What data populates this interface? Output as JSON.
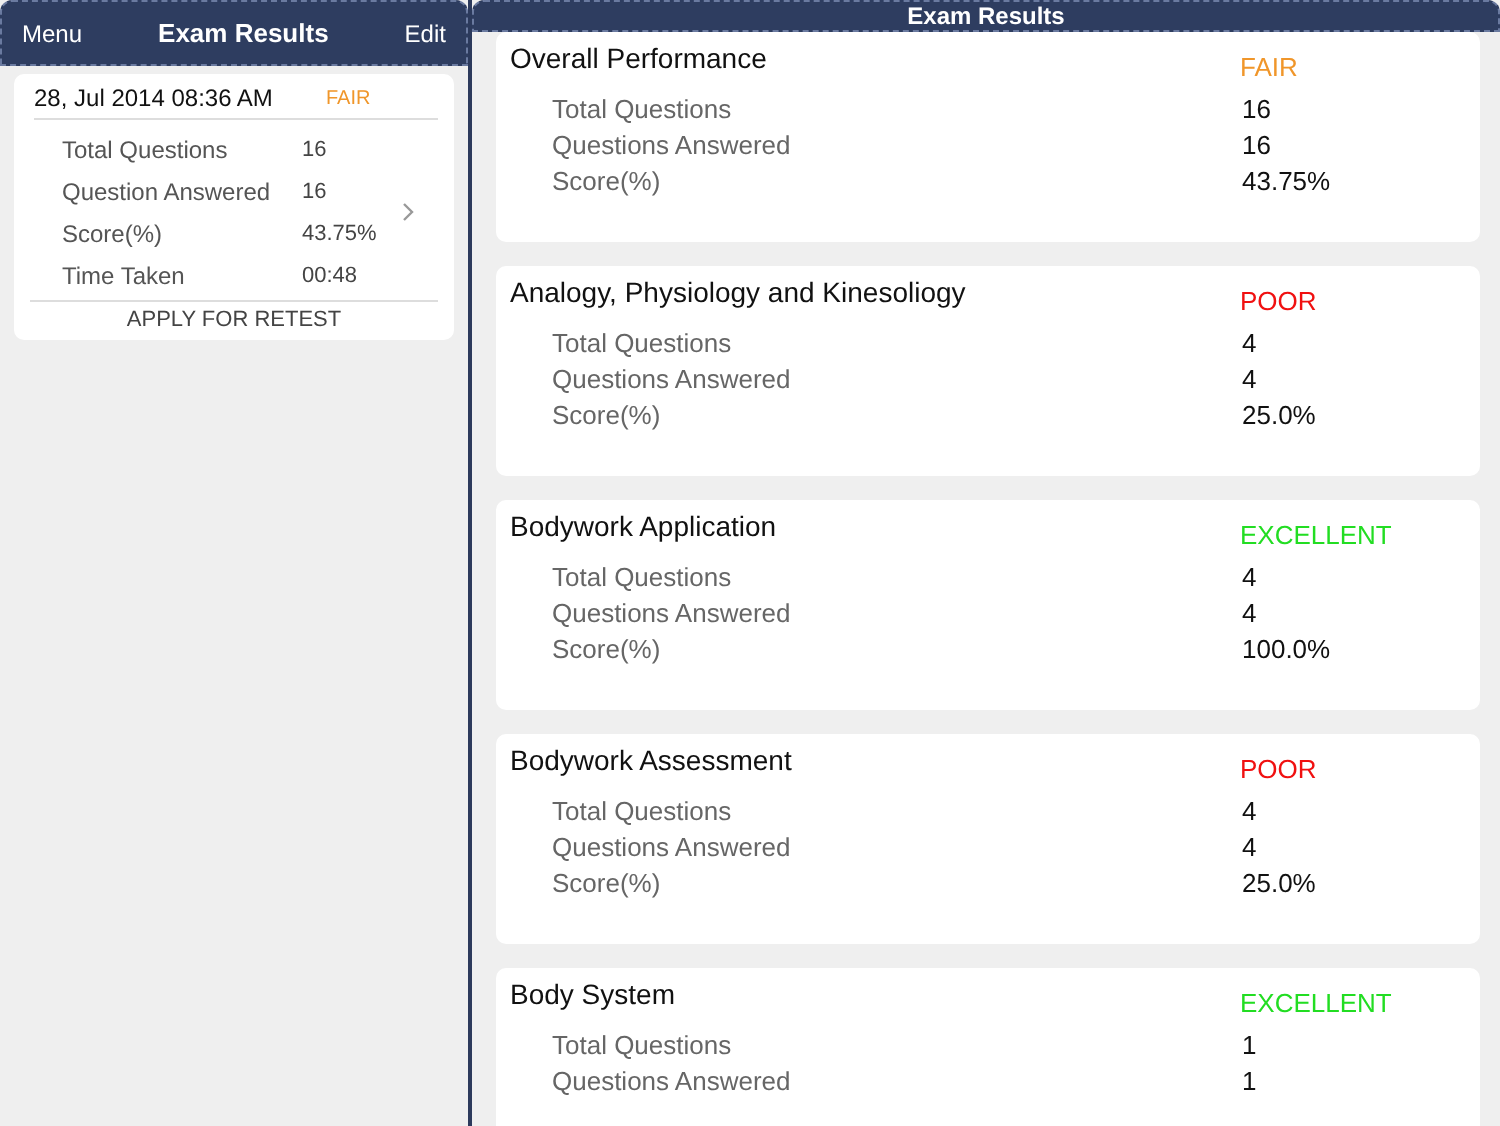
{
  "left_panel": {
    "nav": {
      "menu": "Menu",
      "title": "Exam Results",
      "edit": "Edit"
    },
    "attempt": {
      "date": "28, Jul 2014 08:36 AM",
      "rating": "FAIR",
      "color": "#f0962a",
      "rows": [
        {
          "label": "Total Questions",
          "value": "16"
        },
        {
          "label": "Question Answered",
          "value": "16"
        },
        {
          "label": "Score(%)",
          "value": "43.75%"
        },
        {
          "label": "Time Taken",
          "value": "00:48"
        }
      ],
      "retest": "APPLY FOR RETEST"
    }
  },
  "main_panel": {
    "nav": {
      "title": "Exam Results"
    },
    "sections": [
      {
        "title": "Overall Performance",
        "rating": "FAIR",
        "color": "#f0962a",
        "rows": [
          {
            "label": "Total Questions",
            "value": "16"
          },
          {
            "label": "Questions Answered",
            "value": "16"
          },
          {
            "label": "Score(%)",
            "value": "43.75%"
          }
        ]
      },
      {
        "title": "Analogy, Physiology and Kinesoliogy",
        "rating": "POOR",
        "color": "#f01010",
        "rows": [
          {
            "label": "Total Questions",
            "value": "4"
          },
          {
            "label": "Questions Answered",
            "value": "4"
          },
          {
            "label": "Score(%)",
            "value": "25.0%"
          }
        ]
      },
      {
        "title": "Bodywork Application",
        "rating": "EXCELLENT",
        "color": "#22dd22",
        "rows": [
          {
            "label": "Total Questions",
            "value": "4"
          },
          {
            "label": "Questions Answered",
            "value": "4"
          },
          {
            "label": "Score(%)",
            "value": "100.0%"
          }
        ]
      },
      {
        "title": "Bodywork Assessment",
        "rating": "POOR",
        "color": "#f01010",
        "rows": [
          {
            "label": "Total Questions",
            "value": "4"
          },
          {
            "label": "Questions Answered",
            "value": "4"
          },
          {
            "label": "Score(%)",
            "value": "25.0%"
          }
        ]
      },
      {
        "title": "Body System",
        "rating": "EXCELLENT",
        "color": "#22dd22",
        "rows": [
          {
            "label": "Total Questions",
            "value": "1"
          },
          {
            "label": "Questions Answered",
            "value": "1"
          }
        ]
      }
    ]
  }
}
